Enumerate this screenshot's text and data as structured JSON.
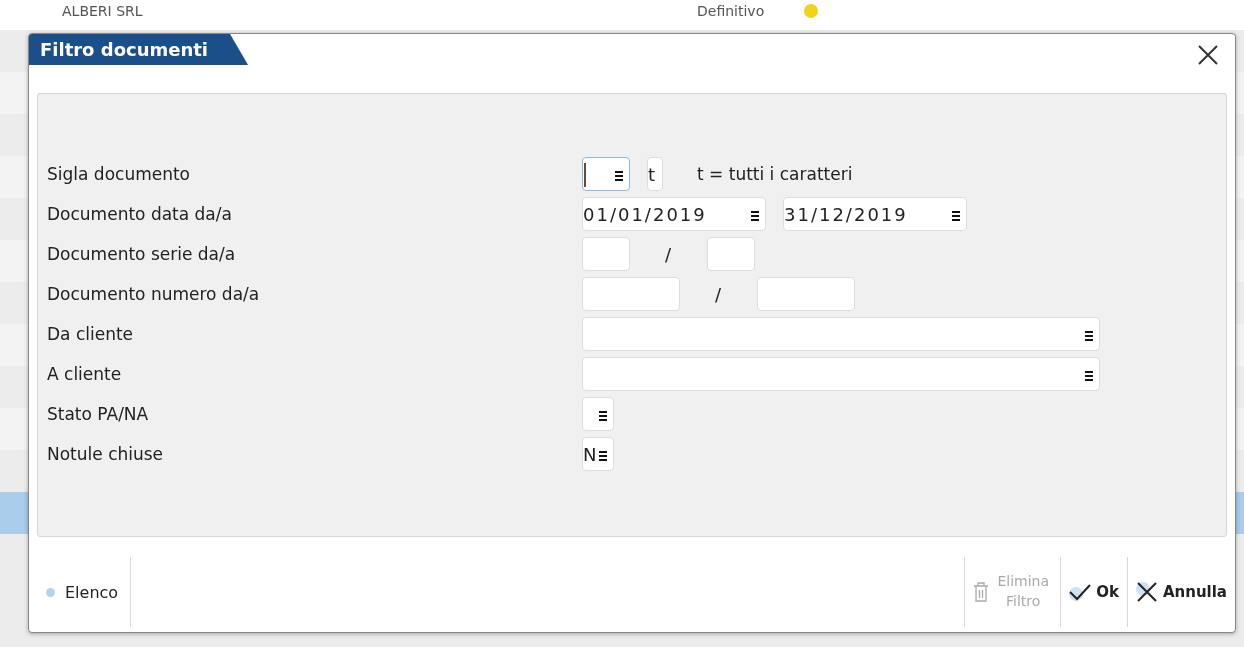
{
  "background": {
    "rows": [
      {
        "name": "ALBERI SRL",
        "status": "Definitivo",
        "color": "#f2d21b"
      }
    ]
  },
  "dialog": {
    "title": "Filtro documenti",
    "fields": [
      {
        "label": "Sigla documento",
        "parts": [
          {
            "kind": "code",
            "menu": true,
            "focused": true
          },
          {
            "kind": "char",
            "value": "t",
            "menu": false,
            "focused": false
          },
          {
            "kind": "hint",
            "text": "t = tutti i caratteri"
          }
        ]
      },
      {
        "label": "Documento data da/a",
        "parts": [
          {
            "kind": "date",
            "value": "01/01/2019",
            "menu": true,
            "focused": false
          },
          {
            "kind": "date",
            "value": "31/12/2019",
            "menu": true,
            "focused": false
          }
        ]
      },
      {
        "label": "Documento serie da/a",
        "parts": [
          {
            "kind": "code",
            "menu": false,
            "focused": false
          },
          {
            "kind": "sep",
            "text": "/"
          },
          {
            "kind": "code",
            "menu": false,
            "focused": false
          }
        ]
      },
      {
        "label": "Documento numero da/a",
        "parts": [
          {
            "kind": "number",
            "menu": false,
            "focused": false
          },
          {
            "kind": "sep",
            "text": "/"
          },
          {
            "kind": "number",
            "menu": false,
            "focused": false
          }
        ]
      },
      {
        "label": "Da cliente",
        "parts": [
          {
            "kind": "lookup",
            "menu": true,
            "focused": false
          }
        ]
      },
      {
        "label": "A cliente",
        "parts": [
          {
            "kind": "lookup",
            "menu": true,
            "focused": false
          }
        ]
      },
      {
        "label": "Stato PA/NA",
        "parts": [
          {
            "kind": "flag",
            "menu": true,
            "focused": false
          }
        ]
      },
      {
        "label": "Notule chiuse",
        "parts": [
          {
            "kind": "flag",
            "value": "N",
            "menu": true,
            "focused": false
          }
        ]
      }
    ],
    "footer": {
      "left": [
        {
          "label": "Elenco",
          "kind": "dot"
        }
      ],
      "right": [
        {
          "label": "Elimina Filtro",
          "kind": "trash",
          "disabled": true
        },
        {
          "label": "Ok",
          "kind": "check",
          "disabled": false
        },
        {
          "label": "Annulla",
          "kind": "cross",
          "disabled": false
        }
      ]
    }
  }
}
